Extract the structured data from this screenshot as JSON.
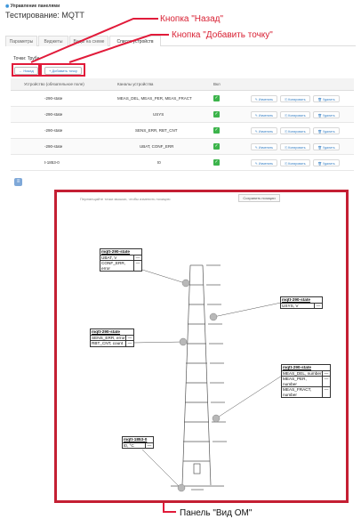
{
  "header": {
    "breadcrumb": "Управление панелями",
    "title": "Тестирование: MQTT"
  },
  "tabs": [
    {
      "label": "Параметры"
    },
    {
      "label": "Виджеты"
    },
    {
      "label": "Виды на схеме"
    },
    {
      "label": "Список устройств"
    }
  ],
  "section_title": "Точки: Труба",
  "toolbar": {
    "back_label": "Назад",
    "add_label": "+ Добавить точку"
  },
  "table": {
    "headers": [
      "Устройство (обязательное поле)",
      "Каналы устройства",
      "Вкл"
    ],
    "rows": [
      {
        "device": "-290-state",
        "channels": "MEAS_DEL, MEAS_PER, MEAS_FRACT",
        "enabled": true
      },
      {
        "device": "-290-state",
        "channels": "USYS",
        "enabled": true
      },
      {
        "device": "-290-state",
        "channels": "SENS_ERR, RBT_CNT",
        "enabled": true
      },
      {
        "device": "-290-state",
        "channels": "UBAT, CONF_ERR",
        "enabled": true
      },
      {
        "device": "t-1853-0",
        "channels": "t0",
        "enabled": true
      }
    ],
    "actions": {
      "edit": "✎ Изменить",
      "copy": "⎘ Копировать",
      "delete": "🗑 Удалить"
    }
  },
  "panel": {
    "hint": "Перемещайте точки мышью, чтобы изменить позицию",
    "save_label": "Сохранить позиции",
    "boxes": [
      {
        "title": "mqtt-290-state",
        "rows": [
          [
            "UBAT, V",
            "—"
          ],
          [
            "CONF_ERR, error",
            "—"
          ]
        ]
      },
      {
        "title": "mqtt-290-state",
        "rows": [
          [
            "USYS, V",
            "—"
          ]
        ]
      },
      {
        "title": "mqtt-290-state",
        "rows": [
          [
            "SENS_ERR, error",
            "—"
          ],
          [
            "RBT_CNT, count",
            "—"
          ]
        ]
      },
      {
        "title": "mqtt-290-state",
        "rows": [
          [
            "MEAS_DEL, number",
            "—"
          ],
          [
            "MEAS_PER, number",
            "—"
          ],
          [
            "MEAS_FRACT, number",
            "—"
          ]
        ]
      },
      {
        "title": "mqtt-1853-0",
        "rows": [
          [
            "t0, °C",
            "—"
          ]
        ]
      }
    ]
  },
  "annotations": {
    "back": "Кнопка \"Назад\"",
    "add": "Кнопка \"Добавить точку\"",
    "om": "Панель \"Вид ОМ\""
  },
  "colors": {
    "accent": "#2f7bc2",
    "highlight": "#e11b3a",
    "checkbox": "#3cb44b"
  }
}
